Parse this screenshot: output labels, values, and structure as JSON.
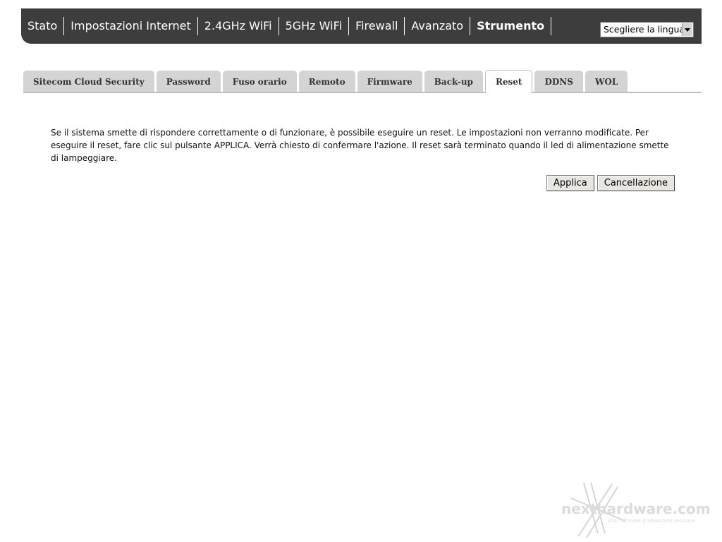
{
  "topnav": {
    "items": [
      {
        "label": "Stato"
      },
      {
        "label": "Impostazioni Internet"
      },
      {
        "label": "2.4GHz WiFi"
      },
      {
        "label": "5GHz WiFi"
      },
      {
        "label": "Firewall"
      },
      {
        "label": "Avanzato"
      },
      {
        "label": "Strumento",
        "active": true
      }
    ],
    "language_select": {
      "value": "Scegliere la lingua"
    }
  },
  "tabs": [
    {
      "label": "Sitecom Cloud Security"
    },
    {
      "label": "Password"
    },
    {
      "label": "Fuso orario"
    },
    {
      "label": "Remoto"
    },
    {
      "label": "Firmware"
    },
    {
      "label": "Back-up"
    },
    {
      "label": "Reset",
      "active": true
    },
    {
      "label": "DDNS"
    },
    {
      "label": "WOL"
    }
  ],
  "content": {
    "description": "Se il sistema smette di rispondere correttamente o di funzionare, è possibile eseguire un reset. Le impostazioni non verranno modificate. Per eseguire il reset, fare clic sul pulsante APPLICA. Verrà chiesto di confermare l'azione. Il reset sarà terminato quando il led di alimentazione smette di lampeggiare.",
    "apply_label": "Applica",
    "cancel_label": "Cancellazione"
  },
  "watermark": {
    "brand": "nexthardware.com",
    "tagline": "your ultimate professional resource"
  },
  "colors": {
    "nav_bg": "#3d3d3d",
    "tab_bg": "#d4d4d4",
    "tab_active_bg": "#ffffff"
  }
}
